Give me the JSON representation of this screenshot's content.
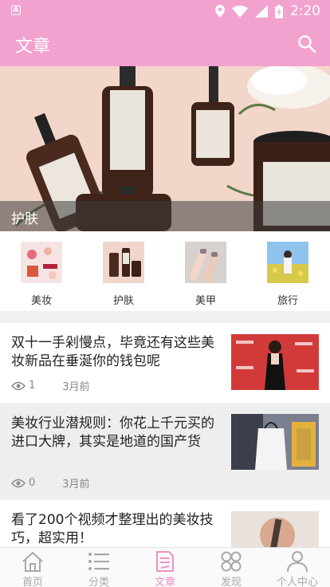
{
  "status_bar": {
    "time": "2:20",
    "left_badge": "A",
    "icons": [
      "location-icon",
      "wifi-icon",
      "signal-icon",
      "battery-icon"
    ]
  },
  "app_bar": {
    "title": "文章",
    "search_icon": "search-icon"
  },
  "banner": {
    "caption": "护肤"
  },
  "categories": [
    {
      "label": "美妆"
    },
    {
      "label": "护肤"
    },
    {
      "label": "美甲"
    },
    {
      "label": "旅行"
    }
  ],
  "articles": [
    {
      "title": "双十一手剁慢点，毕竟还有这些美妆新品在垂涎你的钱包呢",
      "views": "1",
      "time": "3月前"
    },
    {
      "title": "美妆行业潜规则：你花上千元买的进口大牌，其实是地道的国产货",
      "views": "0",
      "time": "3月前"
    },
    {
      "title": "看了200个视频才整理出的美妆技巧，超实用！"
    }
  ],
  "bottom_nav": [
    {
      "label": "首页",
      "icon": "home-icon"
    },
    {
      "label": "分类",
      "icon": "list-icon"
    },
    {
      "label": "文章",
      "icon": "document-icon",
      "active": true
    },
    {
      "label": "发现",
      "icon": "discover-icon"
    },
    {
      "label": "个人中心",
      "icon": "person-icon"
    }
  ],
  "colors": {
    "primary": "#f2a2cf",
    "active_tab": "#ee8fc6",
    "inactive_tab": "#a9a9a9"
  }
}
